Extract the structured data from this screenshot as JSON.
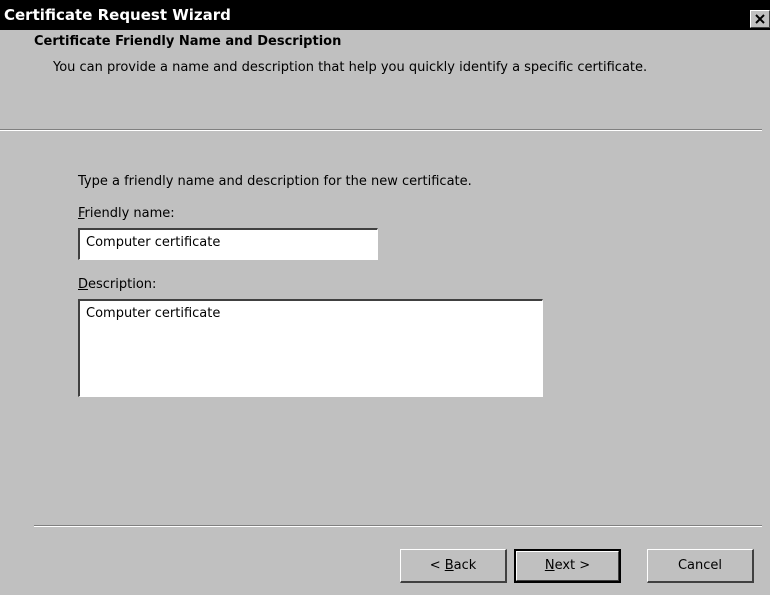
{
  "window": {
    "title": "Certificate Request Wizard",
    "close_icon": "close-icon"
  },
  "header": {
    "title": "Certificate Friendly Name and Description",
    "description": "You can provide a name and description that help you quickly identify a specific certificate."
  },
  "content": {
    "instruction": "Type a friendly name and description for the new certificate.",
    "friendly_name": {
      "label_mnemonic": "F",
      "label_rest": "riendly name:",
      "value": "Computer certificate"
    },
    "description": {
      "label_mnemonic": "D",
      "label_rest": "escription:",
      "value": "Computer certificate"
    }
  },
  "buttons": {
    "back": {
      "prefix": "< ",
      "mnemonic": "B",
      "rest": "ack"
    },
    "next": {
      "mnemonic": "N",
      "rest": "ext >"
    },
    "cancel": {
      "label": "Cancel"
    }
  }
}
